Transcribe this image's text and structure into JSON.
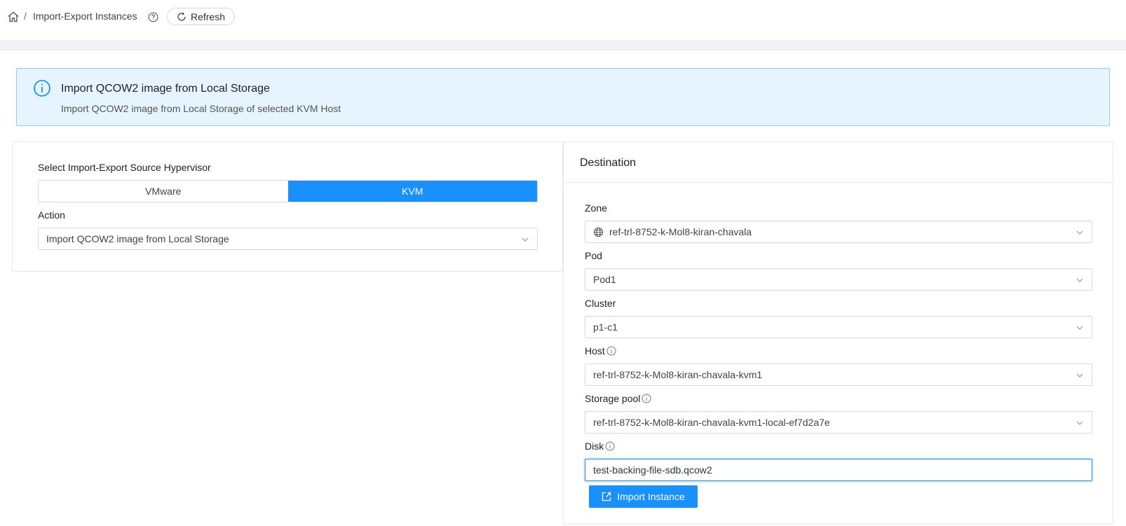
{
  "breadcrumb": {
    "home_icon": "home-icon",
    "separator": "/",
    "title": "Import-Export Instances",
    "help_icon": "question-circle-icon"
  },
  "toolbar": {
    "refresh_label": "Refresh",
    "refresh_icon": "reload-icon"
  },
  "alert": {
    "icon": "info-circle-icon",
    "title": "Import QCOW2 image from Local Storage",
    "description": "Import QCOW2 image from Local Storage of selected KVM Host"
  },
  "source": {
    "hypervisor_label": "Select Import-Export Source Hypervisor",
    "hypervisors": [
      {
        "label": "VMware",
        "selected": false
      },
      {
        "label": "KVM",
        "selected": true
      }
    ],
    "action_label": "Action",
    "action_value": "Import QCOW2 image from Local Storage"
  },
  "destination": {
    "title": "Destination",
    "zone_label": "Zone",
    "zone_value": "ref-trl-8752-k-Mol8-kiran-chavala",
    "pod_label": "Pod",
    "pod_value": "Pod1",
    "cluster_label": "Cluster",
    "cluster_value": "p1-c1",
    "host_label": "Host",
    "host_value": "ref-trl-8752-k-Mol8-kiran-chavala-kvm1",
    "storage_pool_label": "Storage pool",
    "storage_pool_value": "ref-trl-8752-k-Mol8-kiran-chavala-kvm1-local-ef7d2a7e",
    "disk_label": "Disk",
    "disk_value": "test-backing-file-sdb.qcow2",
    "import_button_label": "Import Instance"
  },
  "colors": {
    "primary": "#1890ff",
    "alert_bg": "#e6f4ff",
    "alert_border": "#91caff"
  }
}
